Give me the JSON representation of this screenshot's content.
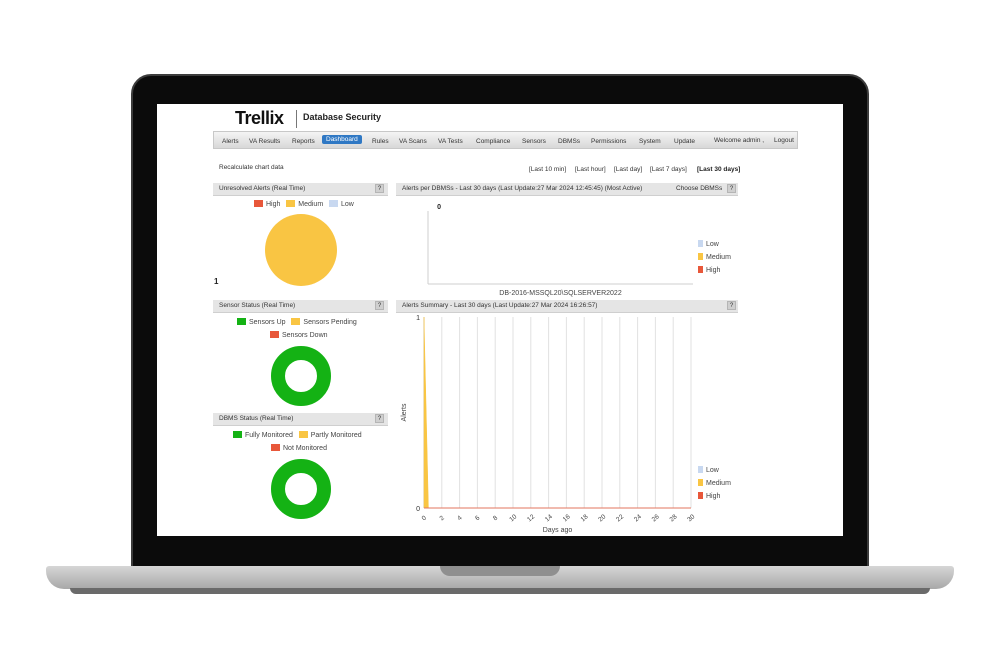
{
  "brand": {
    "logo": "Trellix",
    "product": "Database Security"
  },
  "nav": {
    "tabs": [
      "Alerts",
      "VA Results",
      "Reports",
      "Dashboard",
      "Rules",
      "VA Scans",
      "VA Tests",
      "Compliance",
      "Sensors",
      "DBMSs",
      "Permissions",
      "System",
      "Update"
    ],
    "active": "Dashboard",
    "welcome": "Welcome  admin ,",
    "logout": "Logout"
  },
  "toolbar": {
    "recalc": "Recalculate chart data",
    "time_ranges": [
      "[Last 10 min]",
      "[Last hour]",
      "[Last day]",
      "[Last 7 days]",
      "[Last 30 days]"
    ],
    "selected_range": "[Last 30 days]"
  },
  "panels": {
    "unresolved": {
      "title": "Unresolved Alerts (Real Time)",
      "help": "?",
      "count_label": "1"
    },
    "per_dbms": {
      "title": "Alerts per DBMSs - Last 30 days (Last Update:27 Mar 2024 12:45:45) (Most Active)",
      "choose": "Choose DBMSs",
      "help": "?"
    },
    "sensor": {
      "title": "Sensor Status (Real Time)",
      "help": "?"
    },
    "summary": {
      "title": "Alerts Summary - Last 30 days (Last Update:27 Mar 2024 16:26:57)",
      "help": "?"
    },
    "dbms_status": {
      "title": "DBMS Status (Real Time)",
      "help": "?"
    }
  },
  "legends": {
    "severity": [
      "High",
      "Medium",
      "Low"
    ],
    "sensor": [
      "Sensors Up",
      "Sensors Pending",
      "Sensors Down"
    ],
    "dbms": [
      "Fully Monitored",
      "Partly Monitored",
      "Not Monitored"
    ],
    "severity_vertical": [
      "Low",
      "Medium",
      "High"
    ]
  },
  "colors": {
    "high": "#e8573a",
    "medium": "#f9c543",
    "low": "#c8d8f0",
    "green": "#14b214",
    "active_tab": "#2f78c4"
  },
  "chart_data": [
    {
      "id": "unresolved_pie",
      "type": "pie",
      "title": "Unresolved Alerts (Real Time)",
      "categories": [
        "High",
        "Medium",
        "Low"
      ],
      "values": [
        0,
        1,
        0
      ]
    },
    {
      "id": "per_dbms_bar",
      "type": "bar",
      "title": "Alerts per DBMSs - Last 30 days (Last Update:27 Mar 2024 12:45:45) (Most Active)",
      "categories": [
        "DB-2016-MSSQL20\\SQLSERVER2022"
      ],
      "series": [
        {
          "name": "Low",
          "values": [
            0
          ]
        },
        {
          "name": "Medium",
          "values": [
            0
          ]
        },
        {
          "name": "High",
          "values": [
            0
          ]
        }
      ],
      "y_tick_labels": [
        "0"
      ]
    },
    {
      "id": "sensor_donut",
      "type": "pie",
      "title": "Sensor Status (Real Time)",
      "categories": [
        "Sensors Up",
        "Sensors Pending",
        "Sensors Down"
      ],
      "values": [
        1,
        0,
        0
      ]
    },
    {
      "id": "alerts_summary",
      "type": "area",
      "title": "Alerts Summary - Last 30 days (Last Update:27 Mar 2024 16:26:57)",
      "xlabel": "Days ago",
      "ylabel": "Alerts",
      "ylim": [
        0,
        1
      ],
      "y_ticks": [
        "0",
        "1"
      ],
      "x_ticks": [
        0,
        2,
        4,
        6,
        8,
        10,
        12,
        14,
        16,
        18,
        20,
        22,
        24,
        26,
        28,
        30
      ],
      "series": [
        {
          "name": "Medium",
          "x": [
            0,
            0.5,
            1,
            30
          ],
          "y": [
            1,
            0,
            0,
            0
          ]
        },
        {
          "name": "Low",
          "x": [
            0,
            30
          ],
          "y": [
            0,
            0
          ]
        },
        {
          "name": "High",
          "x": [
            0,
            30
          ],
          "y": [
            0,
            0
          ]
        }
      ]
    },
    {
      "id": "dbms_donut",
      "type": "pie",
      "title": "DBMS Status (Real Time)",
      "categories": [
        "Fully Monitored",
        "Partly Monitored",
        "Not Monitored"
      ],
      "values": [
        1,
        0,
        0
      ]
    }
  ]
}
